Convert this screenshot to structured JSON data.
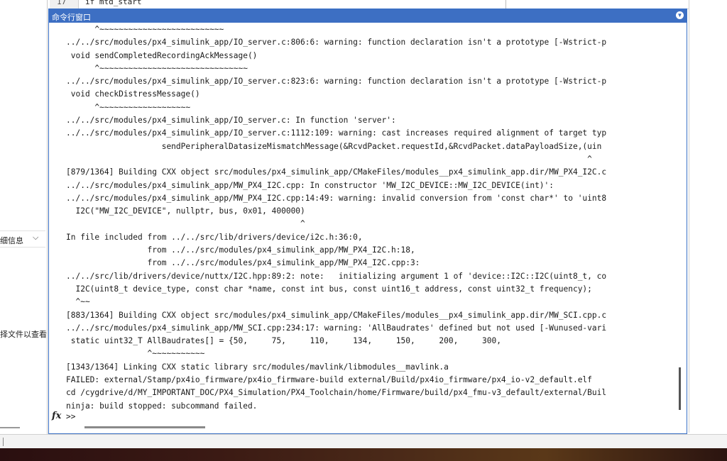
{
  "editor": {
    "line_number": "17",
    "code": "if mtd_start"
  },
  "left_panel": {
    "detail_label": "细信息",
    "hint_text": "择文件以查看"
  },
  "command_window": {
    "title": "命令行窗口",
    "prompt": ">>",
    "lines": [
      "      ^~~~~~~~~~~~~~~~~~~~~~~~~~~",
      "../../src/modules/px4_simulink_app/IO_server.c:806:6: warning: function declaration isn't a prototype [-Wstrict-p",
      " void sendCompletedRecordingAckMessage()",
      "      ^~~~~~~~~~~~~~~~~~~~~~~~~~~~~~~~",
      "../../src/modules/px4_simulink_app/IO_server.c:823:6: warning: function declaration isn't a prototype [-Wstrict-p",
      " void checkDistressMessage()",
      "      ^~~~~~~~~~~~~~~~~~~~",
      "../../src/modules/px4_simulink_app/IO_server.c: In function 'server':",
      "../../src/modules/px4_simulink_app/IO_server.c:1112:109: warning: cast increases required alignment of target typ",
      "                    sendPeripheralDatasizeMismatchMessage(&RcvdPacket.requestId,&RcvdPacket.dataPayloadSize,(uin",
      "                                                                                                             ^",
      "[879/1364] Building CXX object src/modules/px4_simulink_app/CMakeFiles/modules__px4_simulink_app.dir/MW_PX4_I2C.c",
      "../../src/modules/px4_simulink_app/MW_PX4_I2C.cpp: In constructor 'MW_I2C_DEVICE::MW_I2C_DEVICE(int)':",
      "../../src/modules/px4_simulink_app/MW_PX4_I2C.cpp:14:49: warning: invalid conversion from 'const char*' to 'uint8",
      "  I2C(\"MW_I2C_DEVICE\", nullptr, bus, 0x01, 400000)",
      "                                                 ^",
      "In file included from ../../src/lib/drivers/device/i2c.h:36:0,",
      "                 from ../../src/modules/px4_simulink_app/MW_PX4_I2C.h:18,",
      "                 from ../../src/modules/px4_simulink_app/MW_PX4_I2C.cpp:3:",
      "../../src/lib/drivers/device/nuttx/I2C.hpp:89:2: note:   initializing argument 1 of 'device::I2C::I2C(uint8_t, co",
      "  I2C(uint8_t device_type, const char *name, const int bus, const uint16_t address, const uint32_t frequency);",
      "  ^~~",
      "[883/1364] Building CXX object src/modules/px4_simulink_app/CMakeFiles/modules__px4_simulink_app.dir/MW_SCI.cpp.c",
      "../../src/modules/px4_simulink_app/MW_SCI.cpp:234:17: warning: 'AllBaudrates' defined but not used [-Wunused-vari",
      " static uint32_T AllBaudrates[] = {50,     75,     110,     134,     150,     200,     300,",
      "                 ^~~~~~~~~~~~",
      "[1343/1364] Linking CXX static library src/modules/mavlink/libmodules__mavlink.a",
      "FAILED: external/Stamp/px4io_firmware/px4io_firmware-build external/Build/px4io_firmware/px4_io-v2_default.elf",
      "cd /cygdrive/d/MY_IMPORTANT_DOC/PX4_Simulation/PX4_Toolchain/home/Firmware/build/px4_fmu-v3_default/external/Buil",
      "ninja: build stopped: subcommand failed."
    ]
  },
  "icons": {
    "menu": "circle-chevron-down-icon",
    "fx": "fx-icon",
    "chevron": "chevron-down-icon"
  },
  "colors": {
    "title_bar": "#3d6fc3",
    "border": "#3a70c5",
    "text": "#1a1a1a"
  }
}
